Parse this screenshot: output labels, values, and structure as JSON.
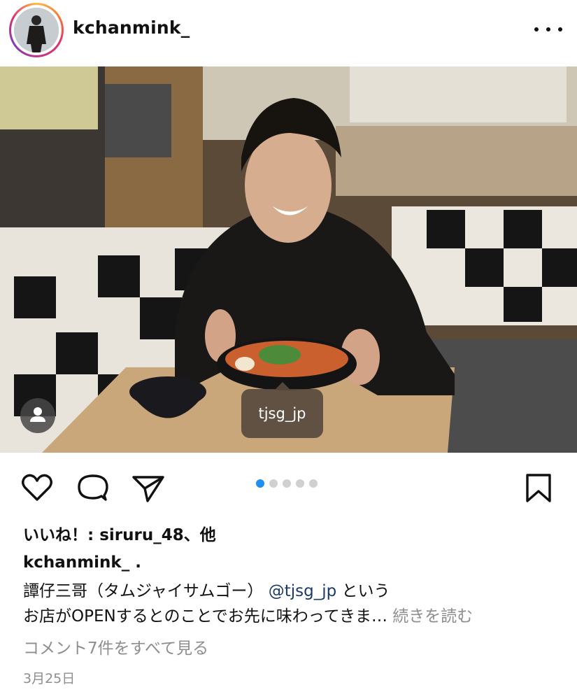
{
  "post": {
    "username": "kchanmink_",
    "brand_tag": "tjsg_jp",
    "likes_text": "いいね！: siruru_48、他",
    "caption_author": "kchanmink_ .",
    "caption_line1": "譚仔三哥（タムジャイサムゴー）",
    "caption_mention": "@tjsg_jp",
    "caption_line1_end": "という",
    "caption_line2": "お店がOPENするとのことでお先に味わってきま…",
    "more_label": "続きを読む",
    "comments_link": "コメント7件をすべて見る",
    "date": "3月25日",
    "carousel": {
      "count": 5,
      "active": 1
    }
  },
  "icons": {
    "more": "more-horizontal-icon",
    "like": "heart-icon",
    "comment": "comment-bubble-icon",
    "share": "paper-plane-icon",
    "save": "bookmark-icon",
    "tagged_people": "person-icon"
  },
  "colors": {
    "accent": "#1f8ff0",
    "mention": "#1a3a6b",
    "muted": "#8e8e8e",
    "tag_bg": "#584a3e"
  }
}
